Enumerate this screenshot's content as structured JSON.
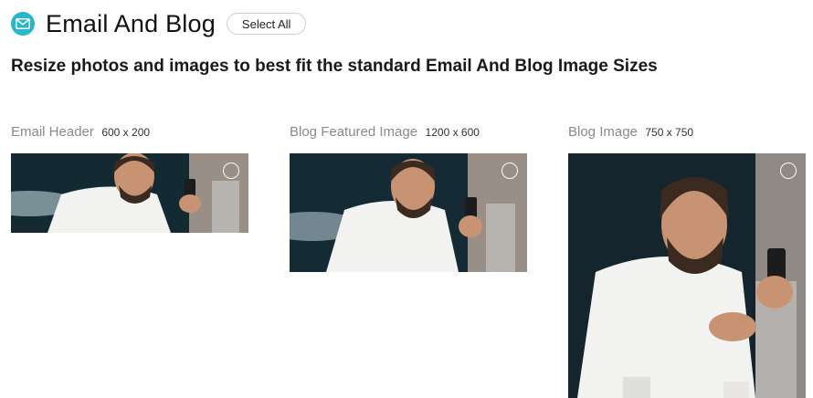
{
  "header": {
    "icon": "envelope-icon",
    "title": "Email And Blog",
    "select_all_label": "Select All"
  },
  "subtitle": "Resize photos and images to best fit the standard Email And Blog Image Sizes",
  "cards": [
    {
      "name": "Email Header",
      "size": "600 x 200",
      "checked": false
    },
    {
      "name": "Blog Featured Image",
      "size": "1200 x 600",
      "checked": false
    },
    {
      "name": "Blog Image",
      "size": "750 x 750",
      "checked": false
    }
  ],
  "colors": {
    "accent": "#29b6c9",
    "label_gray": "#8a8a8a"
  }
}
